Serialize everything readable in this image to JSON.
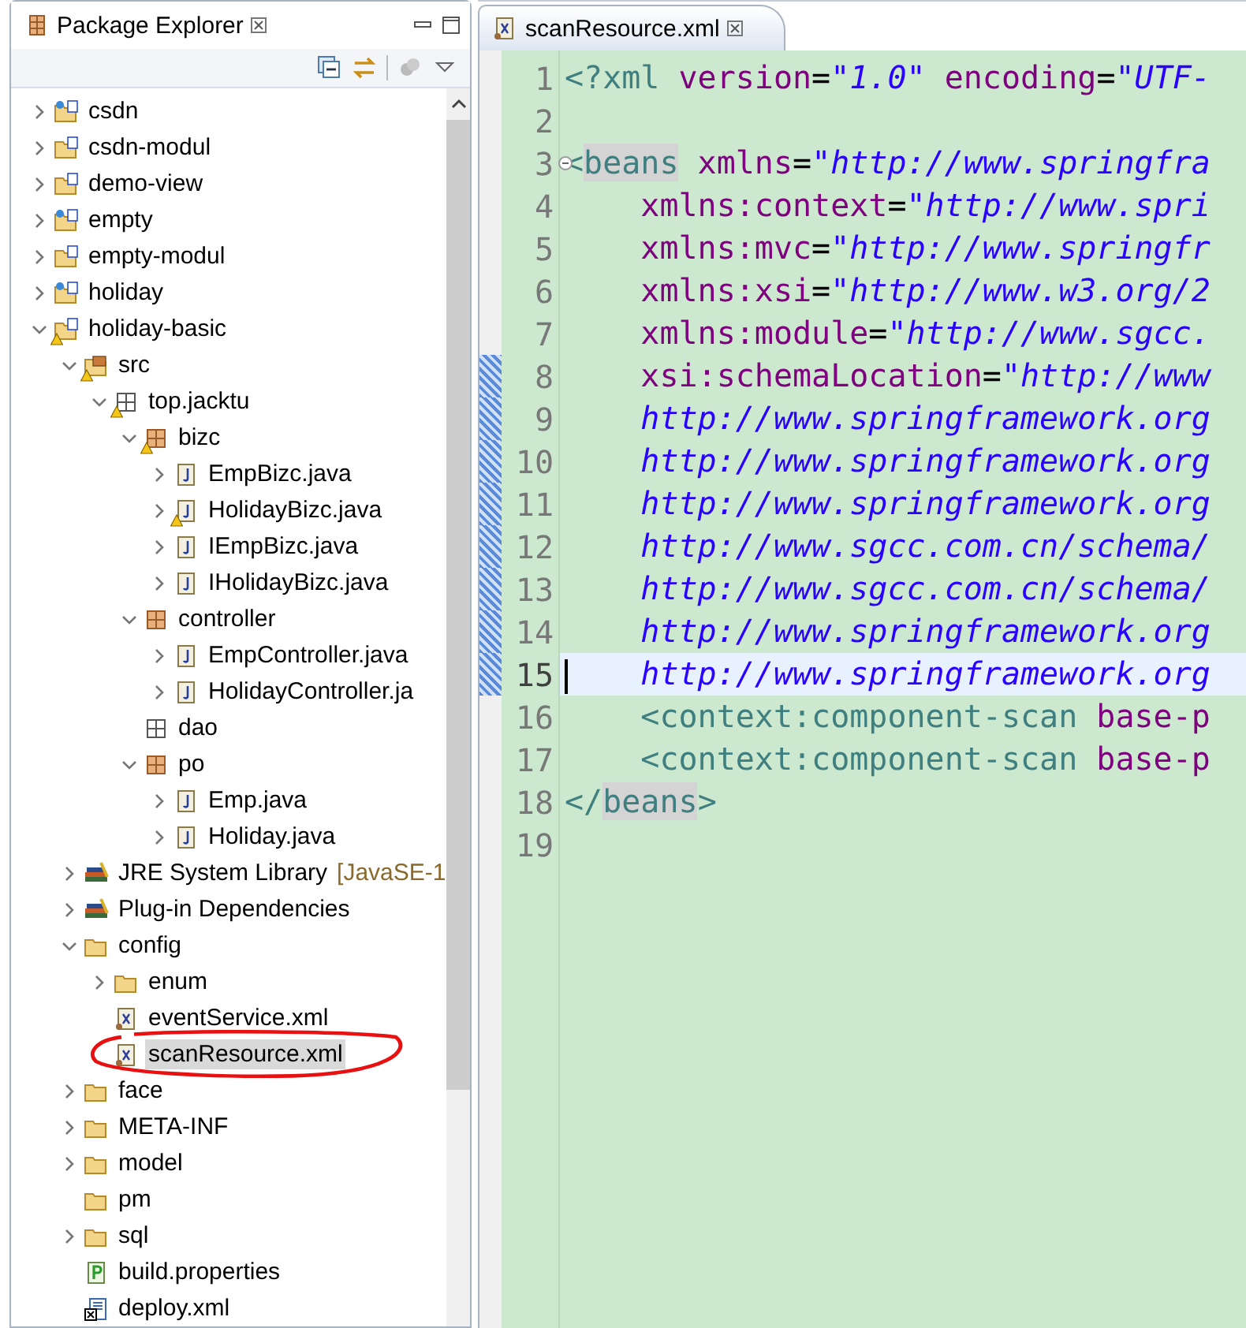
{
  "explorer": {
    "title": "Package Explorer",
    "tree": [
      {
        "label": "csdn",
        "kind": "project-java",
        "toggle": true,
        "expanded": false,
        "warning": false,
        "selected": false
      },
      {
        "label": "csdn-modul",
        "kind": "project-s",
        "toggle": true,
        "expanded": false,
        "warning": false,
        "selected": false
      },
      {
        "label": "demo-view",
        "kind": "project-s",
        "toggle": true,
        "expanded": false,
        "warning": false,
        "selected": false
      },
      {
        "label": "empty",
        "kind": "project-java",
        "toggle": true,
        "expanded": false,
        "warning": false,
        "selected": false
      },
      {
        "label": "empty-modul",
        "kind": "project-s",
        "toggle": true,
        "expanded": false,
        "warning": false,
        "selected": false
      },
      {
        "label": "holiday",
        "kind": "project-java",
        "toggle": true,
        "expanded": false,
        "warning": false,
        "selected": false
      },
      {
        "label": "holiday-basic",
        "kind": "project-s",
        "toggle": true,
        "expanded": true,
        "warning": true,
        "selected": false,
        "children": [
          {
            "label": "src",
            "kind": "source-folder",
            "toggle": true,
            "expanded": true,
            "warning": true,
            "selected": false,
            "children": [
              {
                "label": "top.jacktu",
                "kind": "package-empty",
                "toggle": true,
                "expanded": true,
                "warning": true,
                "selected": false,
                "children": [
                  {
                    "label": "bizc",
                    "kind": "package",
                    "toggle": true,
                    "expanded": true,
                    "warning": true,
                    "selected": false,
                    "children": [
                      {
                        "label": "EmpBizc.java",
                        "kind": "java-file",
                        "toggle": true,
                        "expanded": false,
                        "warning": false,
                        "selected": false
                      },
                      {
                        "label": "HolidayBizc.java",
                        "kind": "java-file",
                        "toggle": true,
                        "expanded": false,
                        "warning": true,
                        "selected": false
                      },
                      {
                        "label": "IEmpBizc.java",
                        "kind": "java-file",
                        "toggle": true,
                        "expanded": false,
                        "warning": false,
                        "selected": false
                      },
                      {
                        "label": "IHolidayBizc.java",
                        "kind": "java-file",
                        "toggle": true,
                        "expanded": false,
                        "warning": false,
                        "selected": false
                      }
                    ]
                  },
                  {
                    "label": "controller",
                    "kind": "package",
                    "toggle": true,
                    "expanded": true,
                    "warning": false,
                    "selected": false,
                    "children": [
                      {
                        "label": "EmpController.java",
                        "kind": "java-file",
                        "toggle": true,
                        "expanded": false,
                        "warning": false,
                        "selected": false
                      },
                      {
                        "label": "HolidayController.ja",
                        "kind": "java-file",
                        "toggle": true,
                        "expanded": false,
                        "warning": false,
                        "selected": false
                      }
                    ]
                  },
                  {
                    "label": "dao",
                    "kind": "package-empty",
                    "toggle": false,
                    "expanded": false,
                    "warning": false,
                    "selected": false
                  },
                  {
                    "label": "po",
                    "kind": "package",
                    "toggle": true,
                    "expanded": true,
                    "warning": false,
                    "selected": false,
                    "children": [
                      {
                        "label": "Emp.java",
                        "kind": "java-file",
                        "toggle": true,
                        "expanded": false,
                        "warning": false,
                        "selected": false
                      },
                      {
                        "label": "Holiday.java",
                        "kind": "java-file",
                        "toggle": true,
                        "expanded": false,
                        "warning": false,
                        "selected": false
                      }
                    ]
                  }
                ]
              }
            ]
          },
          {
            "label": "JRE System Library",
            "decoration": "[JavaSE-1",
            "kind": "library",
            "toggle": true,
            "expanded": false,
            "warning": false,
            "selected": false
          },
          {
            "label": "Plug-in Dependencies",
            "kind": "library",
            "toggle": true,
            "expanded": false,
            "warning": false,
            "selected": false
          },
          {
            "label": "config",
            "kind": "folder",
            "toggle": true,
            "expanded": true,
            "warning": false,
            "selected": false,
            "children": [
              {
                "label": "enum",
                "kind": "folder",
                "toggle": true,
                "expanded": false,
                "warning": false,
                "selected": false
              },
              {
                "label": "eventService.xml",
                "kind": "xml-file",
                "toggle": false,
                "expanded": false,
                "warning": false,
                "selected": false
              },
              {
                "label": "scanResource.xml",
                "kind": "xml-file",
                "toggle": false,
                "expanded": false,
                "warning": false,
                "selected": true
              }
            ]
          },
          {
            "label": "face",
            "kind": "folder",
            "toggle": true,
            "expanded": false,
            "warning": false,
            "selected": false
          },
          {
            "label": "META-INF",
            "kind": "folder",
            "toggle": true,
            "expanded": false,
            "warning": false,
            "selected": false
          },
          {
            "label": "model",
            "kind": "folder",
            "toggle": true,
            "expanded": false,
            "warning": false,
            "selected": false
          },
          {
            "label": "pm",
            "kind": "folder",
            "toggle": false,
            "expanded": false,
            "warning": false,
            "selected": false
          },
          {
            "label": "sql",
            "kind": "folder",
            "toggle": true,
            "expanded": false,
            "warning": false,
            "selected": false
          },
          {
            "label": "build.properties",
            "kind": "properties-file",
            "toggle": false,
            "expanded": false,
            "warning": false,
            "selected": false
          },
          {
            "label": "deploy.xml",
            "kind": "deploy-file",
            "toggle": false,
            "expanded": false,
            "warning": false,
            "selected": false
          }
        ]
      }
    ]
  },
  "editor": {
    "tabs": [
      {
        "label": "scanResource.xml",
        "selected": true
      }
    ],
    "lines": [
      {
        "number": "1",
        "current": false,
        "changed": false,
        "fold": false,
        "segments": [
          {
            "kind": "punct",
            "text": "<?xml"
          },
          {
            "kind": "attr",
            "text": " version"
          },
          {
            "kind": "eq",
            "text": "="
          },
          {
            "kind": "string",
            "text": "\"1.0\""
          },
          {
            "kind": "attr",
            "text": " encoding"
          },
          {
            "kind": "eq",
            "text": "="
          },
          {
            "kind": "string",
            "text": "\"UTF-"
          }
        ]
      },
      {
        "number": "2",
        "current": false,
        "changed": false,
        "fold": false
      },
      {
        "number": "3",
        "current": false,
        "changed": false,
        "fold": true,
        "segments": [
          {
            "kind": "punct",
            "text": "<"
          },
          {
            "kind": "tag-occurrence",
            "text": "beans"
          },
          {
            "kind": "attr",
            "text": " xmlns"
          },
          {
            "kind": "eq",
            "text": "="
          },
          {
            "kind": "string",
            "text": "\"http://www.springfra"
          }
        ]
      },
      {
        "number": "4",
        "current": false,
        "changed": false,
        "fold": false,
        "segments": [
          {
            "kind": "attr",
            "text": "    xmlns:context"
          },
          {
            "kind": "eq",
            "text": "="
          },
          {
            "kind": "string",
            "text": "\"http://www.spri"
          }
        ]
      },
      {
        "number": "5",
        "current": false,
        "changed": false,
        "fold": false,
        "segments": [
          {
            "kind": "attr",
            "text": "    xmlns:mvc"
          },
          {
            "kind": "eq",
            "text": "="
          },
          {
            "kind": "string",
            "text": "\"http://www.springfr"
          }
        ]
      },
      {
        "number": "6",
        "current": false,
        "changed": false,
        "fold": false,
        "segments": [
          {
            "kind": "attr",
            "text": "    xmlns:xsi"
          },
          {
            "kind": "eq",
            "text": "="
          },
          {
            "kind": "string",
            "text": "\"http://www.w3.org/2"
          }
        ]
      },
      {
        "number": "7",
        "current": false,
        "changed": false,
        "fold": false,
        "segments": [
          {
            "kind": "attr",
            "text": "    xmlns:module"
          },
          {
            "kind": "eq",
            "text": "="
          },
          {
            "kind": "string",
            "text": "\"http://www.sgcc."
          }
        ]
      },
      {
        "number": "8",
        "current": false,
        "changed": true,
        "fold": false,
        "segments": [
          {
            "kind": "attr",
            "text": "    xsi:schemaLocation"
          },
          {
            "kind": "eq",
            "text": "="
          },
          {
            "kind": "string",
            "text": "\"http://www"
          }
        ]
      },
      {
        "number": "9",
        "current": false,
        "changed": true,
        "fold": false,
        "segments": [
          {
            "kind": "string",
            "text": "    http://www.springframework.org"
          }
        ]
      },
      {
        "number": "10",
        "current": false,
        "changed": true,
        "fold": false,
        "segments": [
          {
            "kind": "string",
            "text": "    http://www.springframework.org"
          }
        ]
      },
      {
        "number": "11",
        "current": false,
        "changed": true,
        "fold": false,
        "segments": [
          {
            "kind": "string",
            "text": "    http://www.springframework.org"
          }
        ]
      },
      {
        "number": "12",
        "current": false,
        "changed": true,
        "fold": false,
        "segments": [
          {
            "kind": "string",
            "text": "    http://www.sgcc.com.cn/schema/"
          }
        ]
      },
      {
        "number": "13",
        "current": false,
        "changed": true,
        "fold": false,
        "segments": [
          {
            "kind": "string",
            "text": "    http://www.sgcc.com.cn/schema/"
          }
        ]
      },
      {
        "number": "14",
        "current": false,
        "changed": true,
        "fold": false,
        "segments": [
          {
            "kind": "string",
            "text": "    http://www.springframework.org"
          }
        ]
      },
      {
        "number": "15",
        "current": true,
        "changed": true,
        "fold": false,
        "segments": [
          {
            "kind": "string",
            "text": "    http://www.springframework.org"
          }
        ]
      },
      {
        "number": "16",
        "current": false,
        "changed": false,
        "fold": false,
        "segments": [
          {
            "kind": "tag",
            "text": "    <context:component-scan"
          },
          {
            "kind": "attr",
            "text": " base-p"
          }
        ]
      },
      {
        "number": "17",
        "current": false,
        "changed": false,
        "fold": false,
        "segments": [
          {
            "kind": "tag",
            "text": "    <context:component-scan"
          },
          {
            "kind": "attr",
            "text": " base-p"
          }
        ]
      },
      {
        "number": "18",
        "current": false,
        "changed": false,
        "fold": false,
        "segments": [
          {
            "kind": "punct",
            "text": "</"
          },
          {
            "kind": "tag-occurrence",
            "text": "beans"
          },
          {
            "kind": "punct",
            "text": ">"
          }
        ]
      },
      {
        "number": "19",
        "current": false,
        "changed": false,
        "fold": false
      }
    ]
  }
}
